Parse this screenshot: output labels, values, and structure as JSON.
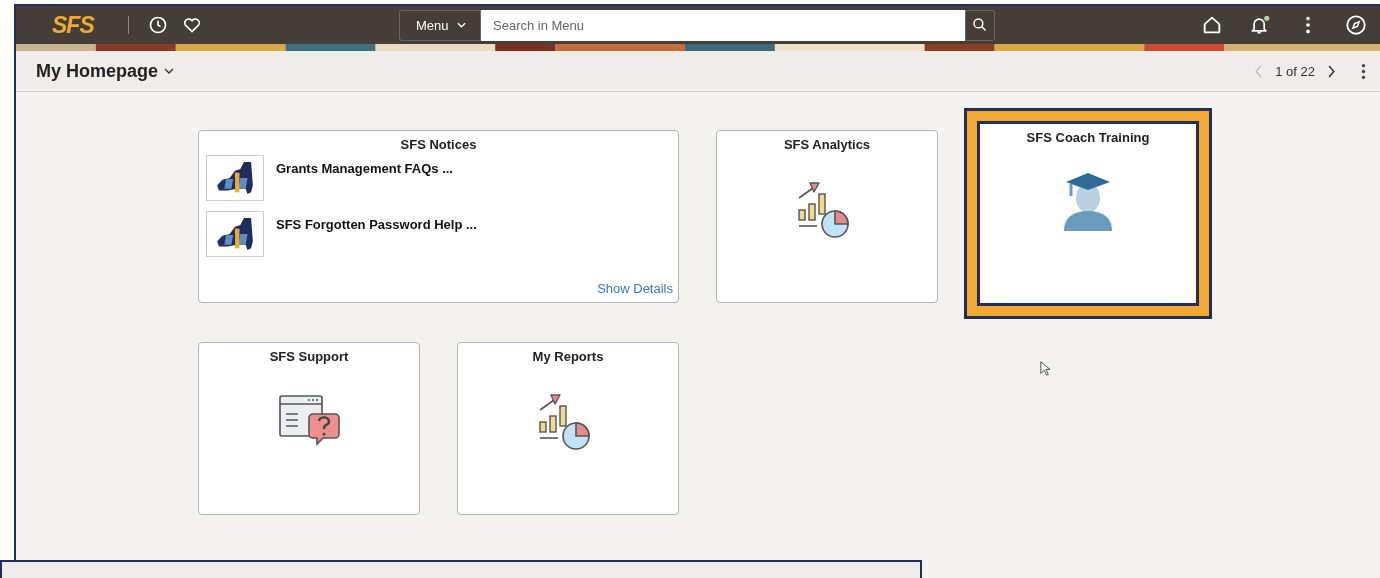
{
  "header": {
    "logo": "SFS",
    "menu_button": "Menu",
    "search": {
      "placeholder": "Search in Menu"
    },
    "notifications": {
      "unread": true
    }
  },
  "page": {
    "title": "My Homepage",
    "pager": "1 of 22"
  },
  "tiles": [
    {
      "kind": "notices",
      "title": "SFS Notices",
      "highlighted": false,
      "items": [
        "Grants Management FAQs ...",
        "SFS Forgotten Password Help ..."
      ],
      "link": "Show Details"
    },
    {
      "kind": "chart",
      "title": "SFS Analytics",
      "highlighted": false
    },
    {
      "kind": "training",
      "title": "SFS Coach Training",
      "highlighted": true
    },
    {
      "kind": "help",
      "title": "SFS Support",
      "highlighted": false
    },
    {
      "kind": "chart",
      "title": "My Reports",
      "highlighted": false
    }
  ]
}
